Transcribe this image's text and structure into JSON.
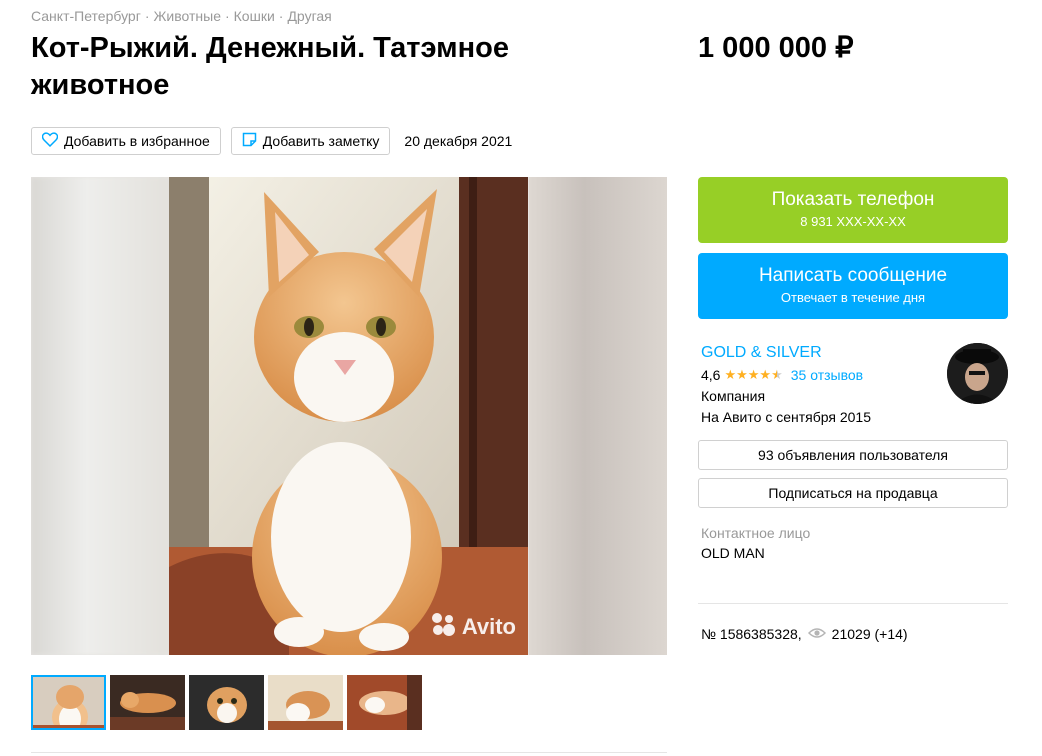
{
  "breadcrumb": [
    "Санкт-Петербург",
    "Животные",
    "Кошки",
    "Другая"
  ],
  "breadcrumb_separator": "·",
  "title": "Кот-Рыжий. Денежный. Татэмное животное",
  "price": "1 000 000 ₽",
  "actions": {
    "favorite_label": "Добавить в избранное",
    "note_label": "Добавить заметку",
    "date": "20 декабря 2021"
  },
  "gallery": {
    "watermark": "Avito",
    "thumbnail_count": 5,
    "active_index": 0
  },
  "contact": {
    "show_phone_label": "Показать телефон",
    "phone_masked": "8 931 XXX-XX-XX",
    "message_label": "Написать сообщение",
    "message_sub": "Отвечает в течение дня"
  },
  "seller": {
    "name": "GOLD & SILVER",
    "rating": "4,6",
    "stars_filled": 4.5,
    "reviews": "35 отзывов",
    "type": "Компания",
    "since": "На Авито с сентября 2015",
    "listings_button": "93 объявления пользователя",
    "subscribe_button": "Подписаться на продавца"
  },
  "contact_person": {
    "label": "Контактное лицо",
    "name": "OLD MAN"
  },
  "meta": {
    "listing_id": "№ 1586385328,",
    "views": "21029 (+14)"
  },
  "colors": {
    "green": "#97cf26",
    "blue": "#00aaff",
    "star": "#ffb021",
    "muted": "#999999"
  }
}
